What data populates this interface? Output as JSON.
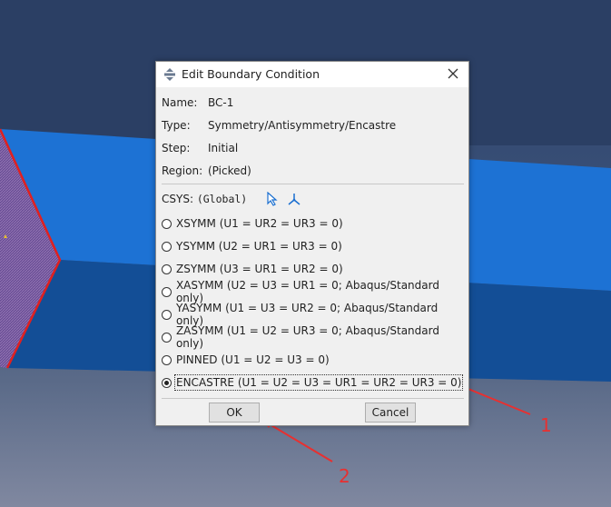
{
  "dialog": {
    "title": "Edit Boundary Condition",
    "name_label": "Name:",
    "name_value": "BC-1",
    "type_label": "Type:",
    "type_value": "Symmetry/Antisymmetry/Encastre",
    "step_label": "Step:",
    "step_value": "Initial",
    "region_label": "Region:",
    "region_value": "(Picked)",
    "csys_label": "CSYS:",
    "csys_value": "(Global)",
    "options": [
      {
        "label": "XSYMM (U1 = UR2 = UR3 = 0)",
        "selected": false
      },
      {
        "label": "YSYMM (U2 = UR1 = UR3 = 0)",
        "selected": false
      },
      {
        "label": "ZSYMM (U3 = UR1 = UR2 = 0)",
        "selected": false
      },
      {
        "label": "XASYMM (U2 = U3 = UR1 = 0; Abaqus/Standard only)",
        "selected": false
      },
      {
        "label": "YASYMM (U1 = U3 = UR2 = 0; Abaqus/Standard only)",
        "selected": false
      },
      {
        "label": "ZASYMM (U1 = U2 = UR3 = 0; Abaqus/Standard only)",
        "selected": false
      },
      {
        "label": "PINNED (U1 = U2 = U3 = 0)",
        "selected": false
      },
      {
        "label": "ENCASTRE (U1 = U2 = U3 = UR1 = UR2 = UR3 = 0)",
        "selected": true
      }
    ],
    "ok_label": "OK",
    "cancel_label": "Cancel"
  },
  "annotations": {
    "marker_1": "1",
    "marker_2": "2"
  },
  "colors": {
    "model_blue": "#1a6fd0",
    "model_blue_dark": "#0f4f9e",
    "edge_red": "#e02020",
    "hatch_purple": "#7a5a9a",
    "annotation_red": "#e83030"
  },
  "icons": [
    "dialog-edit-icon",
    "close-icon",
    "select-csys-arrow-icon",
    "create-csys-axes-icon"
  ]
}
